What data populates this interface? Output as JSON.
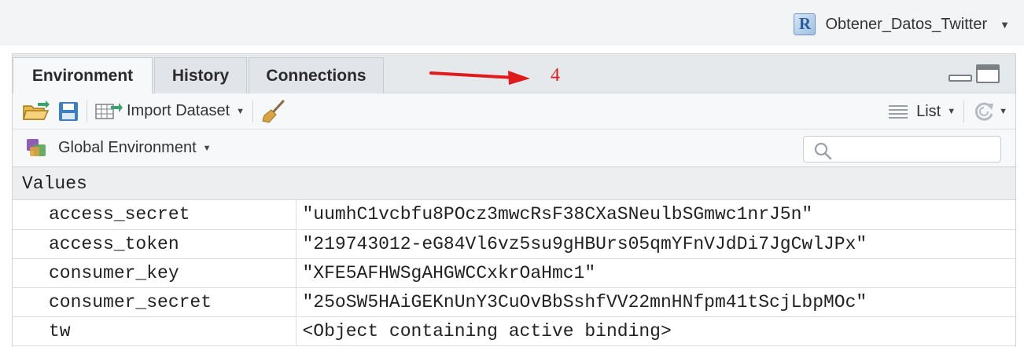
{
  "project": {
    "name": "Obtener_Datos_Twitter",
    "icon": "r-project-icon"
  },
  "tabs": [
    {
      "label": "Environment",
      "active": true
    },
    {
      "label": "History",
      "active": false
    },
    {
      "label": "Connections",
      "active": false
    }
  ],
  "annotation": {
    "number": "4",
    "color": "#e01b1b"
  },
  "toolbar": {
    "open_icon": "open-folder-icon",
    "save_icon": "save-icon",
    "import_label": "Import Dataset",
    "broom_icon": "broom-icon",
    "view_label": "List",
    "refresh_icon": "refresh-icon"
  },
  "environment": {
    "selector_label": "Global Environment",
    "search_placeholder": ""
  },
  "values": {
    "header": "Values",
    "rows": [
      {
        "name": "access_secret",
        "value": "\"uumhC1vcbfu8POcz3mwcRsF38CXaSNeulbSGmwc1nrJ5n\""
      },
      {
        "name": "access_token",
        "value": "\"219743012-eG84Vl6vz5su9gHBUrs05qmYFnVJdDi7JgCwlJPx\""
      },
      {
        "name": "consumer_key",
        "value": "\"XFE5AFHWSgAHGWCCxkrOaHmc1\""
      },
      {
        "name": "consumer_secret",
        "value": "\"25oSW5HAiGEKnUnY3CuOvBbSshfVV22mnHNfpm41tScjLbpMOc\""
      },
      {
        "name": "tw",
        "value": "<Object containing active binding>"
      }
    ]
  }
}
